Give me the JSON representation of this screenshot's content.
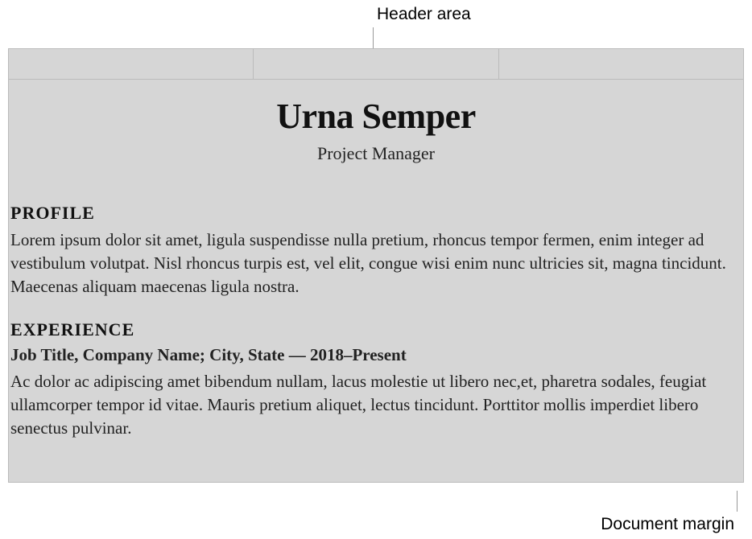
{
  "annotations": {
    "top_label": "Header area",
    "bottom_label": "Document margin"
  },
  "document": {
    "name": "Urna Semper",
    "subtitle": "Project Manager",
    "sections": {
      "profile": {
        "heading": "PROFILE",
        "body": "Lorem ipsum dolor sit amet, ligula suspendisse nulla pretium, rhoncus tempor fermen, enim integer ad vestibulum volutpat. Nisl rhoncus turpis est, vel elit, congue wisi enim nunc ultricies sit, magna tincidunt. Maecenas aliquam maecenas ligula nostra."
      },
      "experience": {
        "heading": "EXPERIENCE",
        "job_line": "Job Title, Company Name; City, State — 2018–Present",
        "body": "Ac dolor ac adipiscing amet bibendum nullam, lacus molestie ut libero nec,et, pharetra sodales, feugiat ullamcorper tempor id vitae. Mauris pretium aliquet, lectus tincidunt. Porttitor mollis imperdiet libero senectus pulvinar."
      }
    }
  }
}
